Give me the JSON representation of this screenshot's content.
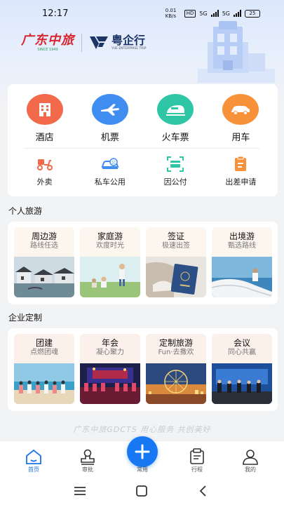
{
  "status_bar": {
    "time": "12:17",
    "net_speed": "0.01 KB/s",
    "hd": "HD",
    "network_1": "5G",
    "network_2": "5G",
    "battery": "25"
  },
  "header": {
    "logo_gdcts": {
      "text": "广东中旅",
      "sub": "SINCE 1949"
    },
    "logo_yqx": {
      "name": "粤企行",
      "en": "YUE ENTERPRISE TRIP"
    }
  },
  "services": {
    "primary": [
      {
        "label": "酒店",
        "icon": "hotel-icon",
        "color": "#f26a4b"
      },
      {
        "label": "机票",
        "icon": "airplane-icon",
        "color": "#3f8df0"
      },
      {
        "label": "火车票",
        "icon": "train-icon",
        "color": "#2fc6a6"
      },
      {
        "label": "用车",
        "icon": "car-icon",
        "color": "#f7913a"
      }
    ],
    "secondary": [
      {
        "label": "外卖",
        "icon": "scooter-icon",
        "color": "#f26a4b"
      },
      {
        "label": "私车公用",
        "icon": "private-car-icon",
        "color": "#3f8df0"
      },
      {
        "label": "因公付",
        "icon": "scan-pay-icon",
        "color": "#2fc6a6"
      },
      {
        "label": "出差申请",
        "icon": "trip-request-icon",
        "color": "#f7913a"
      }
    ]
  },
  "personal_travel": {
    "title": "个人旅游",
    "items": [
      {
        "title": "周边游",
        "sub": "路线任选"
      },
      {
        "title": "家庭游",
        "sub": "欢度时光"
      },
      {
        "title": "签证",
        "sub": "极速出签"
      },
      {
        "title": "出境游",
        "sub": "甄选路线"
      }
    ]
  },
  "enterprise_custom": {
    "title": "企业定制",
    "items": [
      {
        "title": "团建",
        "sub": "点燃团魂"
      },
      {
        "title": "年会",
        "sub": "凝心聚力"
      },
      {
        "title": "定制旅游",
        "sub": "Fun·去撒欢"
      },
      {
        "title": "会议",
        "sub": "同心共赢"
      }
    ]
  },
  "slogan": "广东中旅GDCTS  用心服务 共创美好",
  "tabbar": {
    "home": "首页",
    "approval": "审批",
    "common": "常用",
    "itinerary": "行程",
    "mine": "我的"
  },
  "colors": {
    "accent": "#1878f3",
    "hotel": "#f26a4b",
    "flight": "#3f8df0",
    "train": "#2fc6a6",
    "car": "#f7913a"
  }
}
